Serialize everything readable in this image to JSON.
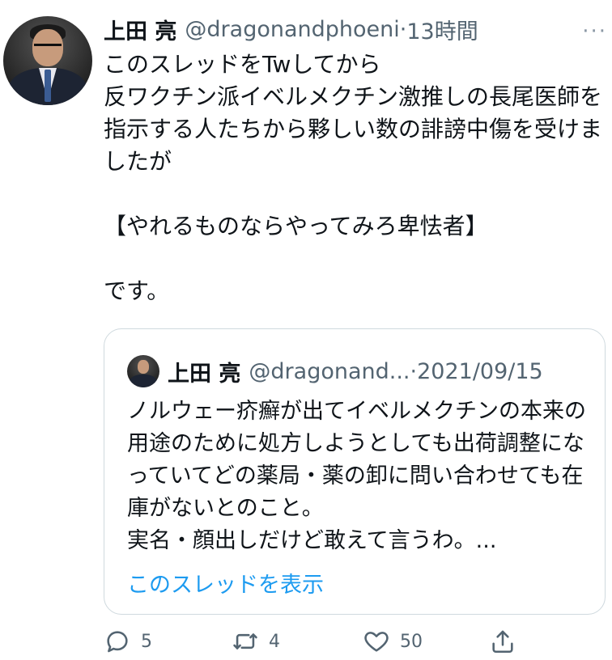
{
  "tweet": {
    "author_name": "上田 亮",
    "author_handle": "@dragonandphoeni",
    "separator": "·",
    "time": "13時間",
    "more": "···",
    "text": "このスレッドをTwしてから\n反ワクチン派イベルメクチン激推しの長尾医師を指示する人たちから夥しい数の誹謗中傷を受けましたが\n\n【やれるものならやってみろ卑怯者】\n\nです。"
  },
  "quote": {
    "author_name": "上田 亮",
    "author_handle": "@dragonand...",
    "separator": "·",
    "date": "2021/09/15",
    "text": "ノルウェー疥癬が出てイベルメクチンの本来の用途のために処方しようとしても出荷調整になっていてどの薬局・薬の卸に問い合わせても在庫がないとのこと。\n実名・顔出しだけど敢えて言うわ。...",
    "show_thread": "このスレッドを表示"
  },
  "actions": {
    "reply_count": "5",
    "retweet_count": "4",
    "like_count": "50"
  },
  "icons": {
    "reply": "reply-icon",
    "retweet": "retweet-icon",
    "like": "heart-icon",
    "share": "share-icon"
  },
  "colors": {
    "link": "#1d9bf0",
    "secondary_text": "#536471",
    "border": "#cfd9de"
  }
}
